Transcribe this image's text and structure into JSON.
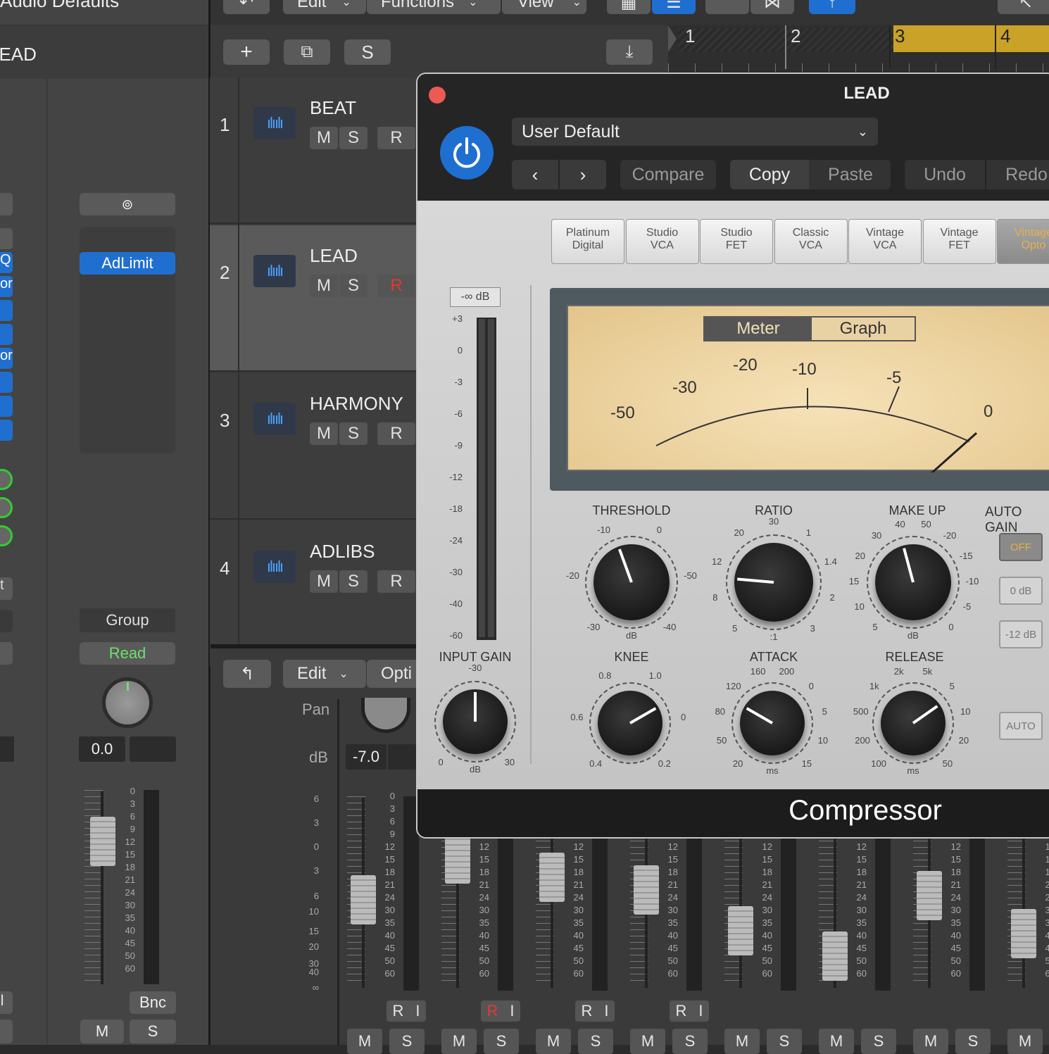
{
  "app": {
    "accent_blue": "#1f6fd1",
    "accent_yellow": "#c9a227"
  },
  "toolbar": {
    "edit_label": "Edit",
    "functions_label": "Functions",
    "view_label": "View",
    "add_track": "+",
    "s_button": "S"
  },
  "ruler": {
    "bars": [
      "1",
      "2",
      "3",
      "4"
    ]
  },
  "inspector": {
    "title": "Audio Defaults",
    "track_name": "LEAD",
    "plugin_slot": "AdLimit",
    "group_label": "Group",
    "automation_label": "Read",
    "pan_value": "0.0",
    "bounce_label": "Bnc",
    "mute_label": "M",
    "solo_label": "S",
    "fader_scale": [
      "0",
      "3",
      "6",
      "9",
      "12",
      "15",
      "18",
      "21",
      "24",
      "30",
      "35",
      "40",
      "45",
      "50",
      "60"
    ]
  },
  "tracks": [
    {
      "number": "1",
      "name": "BEAT",
      "m": "M",
      "s": "S",
      "r": "R",
      "armed": false
    },
    {
      "number": "2",
      "name": "LEAD",
      "m": "M",
      "s": "S",
      "r": "R",
      "armed": true
    },
    {
      "number": "3",
      "name": "HARMONY",
      "m": "M",
      "s": "S",
      "r": "R",
      "armed": false
    },
    {
      "number": "4",
      "name": "ADLIBS",
      "m": "M",
      "s": "S",
      "r": "R",
      "armed": false
    }
  ],
  "mixer": {
    "edit_label": "Edit",
    "options_label": "Opti",
    "pan_label": "Pan",
    "db_label": "dB",
    "db_value": "-7.0",
    "left_scale": [
      "6",
      "3",
      "0",
      "3",
      "6",
      "10",
      "15",
      "20",
      "30",
      "40",
      "∞"
    ],
    "strip_scale": [
      "0",
      "3",
      "6",
      "9",
      "12",
      "15",
      "18",
      "21",
      "24",
      "30",
      "35",
      "40",
      "45",
      "50",
      "60"
    ],
    "strips": [
      {
        "r": "R",
        "i": "I",
        "m": "M",
        "s": "S",
        "armed": false
      },
      {
        "r": "R",
        "i": "I",
        "m": "M",
        "s": "S",
        "armed": true
      },
      {
        "r": "R",
        "i": "I",
        "m": "M",
        "s": "S",
        "armed": false
      },
      {
        "r": "R",
        "i": "I",
        "m": "M",
        "s": "S",
        "armed": false
      },
      {
        "r": "",
        "i": "",
        "m": "M",
        "s": "S",
        "armed": false
      },
      {
        "r": "",
        "i": "",
        "m": "M",
        "s": "S",
        "armed": false
      },
      {
        "r": "",
        "i": "",
        "m": "M",
        "s": "S",
        "armed": false
      },
      {
        "r": "",
        "i": "",
        "m": "M",
        "s": "",
        "armed": false
      }
    ]
  },
  "plugin": {
    "window_title": "LEAD",
    "preset": "User Default",
    "compare_label": "Compare",
    "copy_label": "Copy",
    "paste_label": "Paste",
    "undo_label": "Undo",
    "redo_label": "Redo",
    "footer_title": "Compressor",
    "models": [
      {
        "line1": "Platinum",
        "line2": "Digital",
        "active": false
      },
      {
        "line1": "Studio",
        "line2": "VCA",
        "active": false
      },
      {
        "line1": "Studio",
        "line2": "FET",
        "active": false
      },
      {
        "line1": "Classic",
        "line2": "VCA",
        "active": false
      },
      {
        "line1": "Vintage",
        "line2": "VCA",
        "active": false
      },
      {
        "line1": "Vintage",
        "line2": "FET",
        "active": false
      },
      {
        "line1": "Vintage",
        "line2": "Opto",
        "active": true
      }
    ],
    "input_meter": {
      "peak_label": "-∞ dB",
      "scale": [
        "+3",
        "0",
        "-3",
        "-6",
        "-9",
        "-12",
        "-18",
        "-24",
        "-30",
        "-40",
        "-60"
      ]
    },
    "vu": {
      "meter_label": "Meter",
      "graph_label": "Graph",
      "scale": [
        "-50",
        "-30",
        "-20",
        "-10",
        "-5",
        "0"
      ]
    },
    "knobs": {
      "threshold": {
        "label": "THRESHOLD",
        "scale": [
          "-30",
          "-20",
          "-10",
          "0",
          "-50",
          "-40"
        ],
        "unit": "dB"
      },
      "ratio": {
        "label": "RATIO",
        "scale": [
          "5",
          "8",
          "12",
          "20",
          "30",
          "1",
          "1.4",
          "2",
          "3"
        ],
        "unit": ":1"
      },
      "makeup": {
        "label": "MAKE UP",
        "scale": [
          "5",
          "10",
          "15",
          "20",
          "30",
          "40",
          "50",
          "-20",
          "-15",
          "-10",
          "-5",
          "0"
        ],
        "unit": "dB"
      },
      "input_gain": {
        "label": "INPUT GAIN",
        "scale": [
          "0",
          "-30",
          "30"
        ],
        "unit": "dB"
      },
      "knee": {
        "label": "KNEE",
        "scale": [
          "0.4",
          "0.6",
          "0.8",
          "1.0",
          "0",
          "0.2"
        ]
      },
      "attack": {
        "label": "ATTACK",
        "scale": [
          "20",
          "50",
          "80",
          "120",
          "160",
          "200",
          "0",
          "5",
          "10",
          "15"
        ],
        "unit": "ms"
      },
      "release": {
        "label": "RELEASE",
        "scale": [
          "100",
          "200",
          "500",
          "1k",
          "2k",
          "5k",
          "5",
          "10",
          "20",
          "50"
        ],
        "unit": "ms"
      }
    },
    "auto_gain": {
      "label": "AUTO GAIN",
      "off": "OFF",
      "zero": "0 dB",
      "minus12": "-12 dB",
      "auto": "AUTO"
    }
  }
}
